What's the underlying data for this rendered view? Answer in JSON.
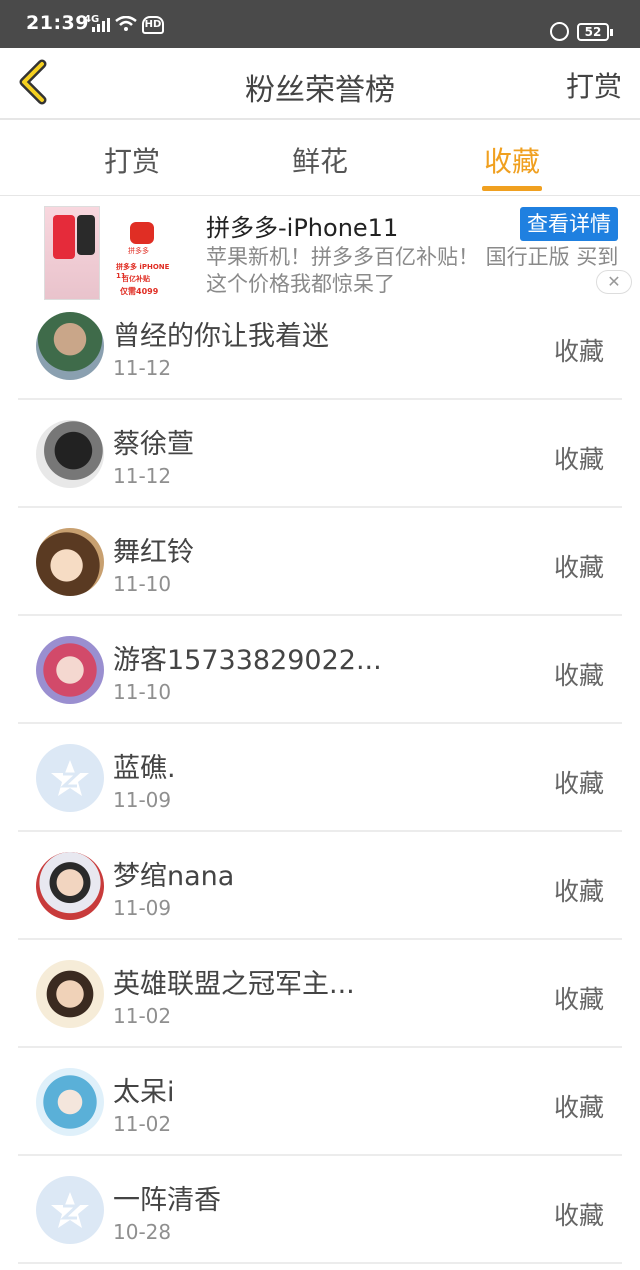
{
  "statusbar": {
    "time": "21:39",
    "network": "4G",
    "hd": "HD",
    "battery": "52"
  },
  "navbar": {
    "title": "粉丝荣誉榜",
    "action": "打赏"
  },
  "tabs": [
    {
      "label": "打赏",
      "active": false
    },
    {
      "label": "鲜花",
      "active": false
    },
    {
      "label": "收藏",
      "active": true
    }
  ],
  "ad": {
    "title": "拼多多-iPhone11",
    "button": "查看详情",
    "description": "苹果新机！拼多多百亿补贴！ 国行正版 买到这个价格我都惊呆了",
    "thumb_brand": "拼多多",
    "thumb_line1": "拼多多 iPHONE 11",
    "thumb_line2": "百亿补贴",
    "thumb_line3": "仅需4099"
  },
  "fans": [
    {
      "name": "曾经的你让我着迷",
      "date": "11-12",
      "type": "收藏",
      "avatar": "photo"
    },
    {
      "name": "蔡徐萱",
      "date": "11-12",
      "type": "收藏",
      "avatar": "photo"
    },
    {
      "name": "舞红铃",
      "date": "11-10",
      "type": "收藏",
      "avatar": "photo"
    },
    {
      "name": "游客15733829022...",
      "date": "11-10",
      "type": "收藏",
      "avatar": "photo"
    },
    {
      "name": "蓝礁.",
      "date": "11-09",
      "type": "收藏",
      "avatar": "default"
    },
    {
      "name": "梦绾nana",
      "date": "11-09",
      "type": "收藏",
      "avatar": "photo"
    },
    {
      "name": "英雄联盟之冠军主...",
      "date": "11-02",
      "type": "收藏",
      "avatar": "photo"
    },
    {
      "name": "太呆i",
      "date": "11-02",
      "type": "收藏",
      "avatar": "photo"
    },
    {
      "name": "一阵清香",
      "date": "10-28",
      "type": "收藏",
      "avatar": "default"
    }
  ],
  "colors": {
    "accent": "#f0a020",
    "ad_button": "#1f80e0",
    "statusbar": "#4a4a4a"
  }
}
